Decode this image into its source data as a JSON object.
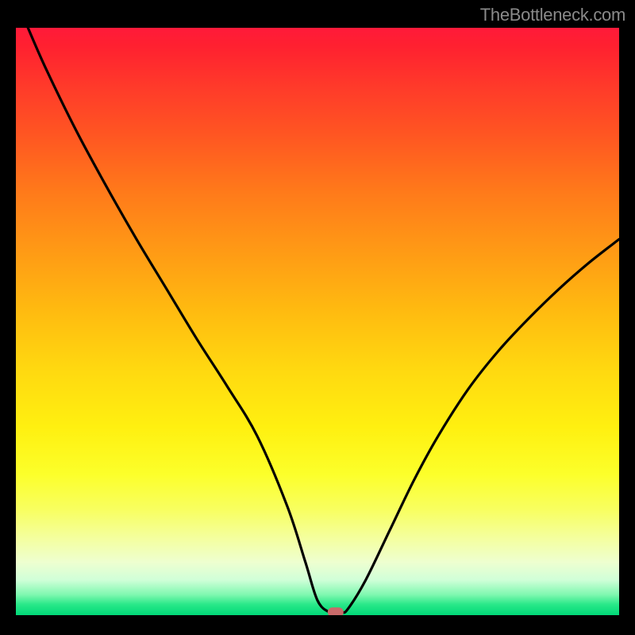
{
  "watermark": "TheBottleneck.com",
  "chart_data": {
    "type": "line",
    "title": "",
    "xlabel": "",
    "ylabel": "",
    "xlim": [
      0,
      100
    ],
    "ylim": [
      0,
      100
    ],
    "x": [
      2,
      5,
      10,
      15,
      20,
      25,
      30,
      35,
      40,
      45,
      48,
      50,
      52,
      54,
      55,
      58,
      62,
      66,
      70,
      75,
      80,
      85,
      90,
      95,
      100
    ],
    "y": [
      100,
      93,
      82.5,
      73,
      64,
      55.5,
      47,
      39,
      30.5,
      18.5,
      9,
      2.5,
      0.5,
      0.5,
      1,
      6,
      14.5,
      23,
      30.5,
      38.5,
      45,
      50.5,
      55.5,
      60,
      64
    ],
    "minimum_point": {
      "x": 53,
      "y": 0.5
    },
    "background_gradient_stops": [
      {
        "pct": 0,
        "color": "#ff1a3a"
      },
      {
        "pct": 50,
        "color": "#ffd810"
      },
      {
        "pct": 90,
        "color": "#eeffd0"
      },
      {
        "pct": 100,
        "color": "#00d878"
      }
    ],
    "curve_color": "#000000",
    "marker_color": "#c96a6a"
  }
}
